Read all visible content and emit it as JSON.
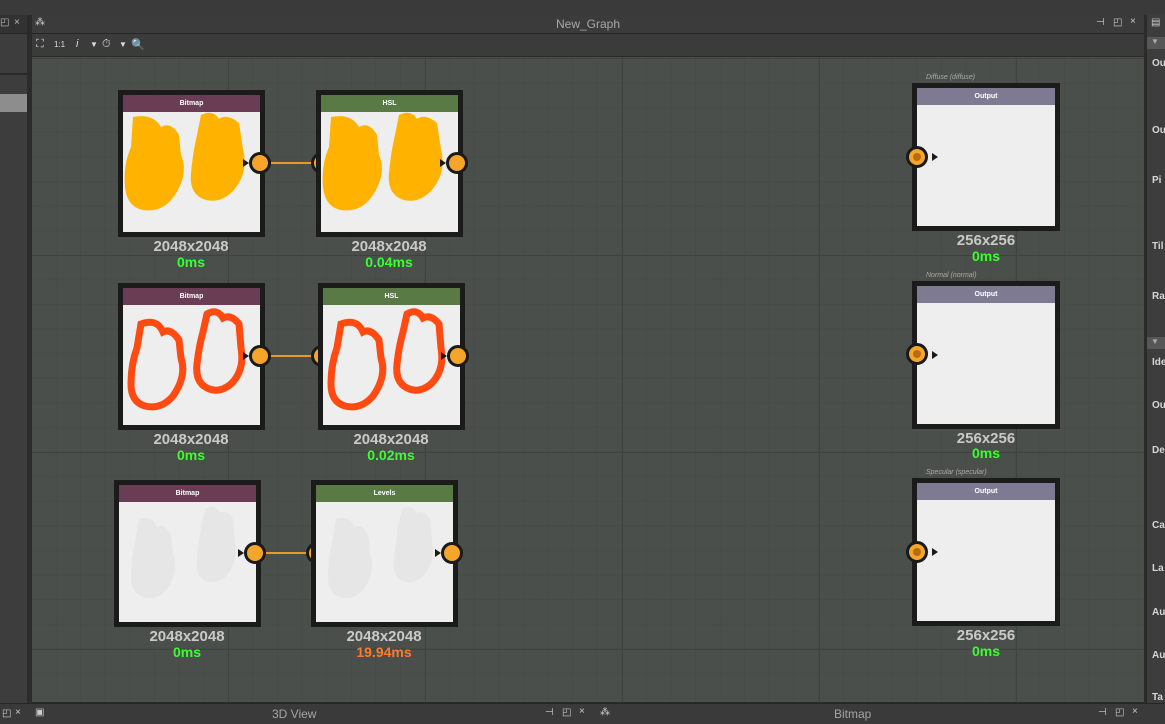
{
  "graph_window": {
    "title": "New_Graph"
  },
  "toolbar": {
    "ratio_label": "1:1",
    "info_label": "i"
  },
  "nodes": [
    {
      "header": "Bitmap",
      "size": "2048x2048",
      "time": "0ms",
      "color": "#6a3d55"
    },
    {
      "header": "HSL",
      "size": "2048x2048",
      "time": "0.04ms",
      "color": "#5a7a45"
    },
    {
      "header": "Bitmap",
      "size": "2048x2048",
      "time": "0ms",
      "color": "#6a3d55"
    },
    {
      "header": "HSL",
      "size": "2048x2048",
      "time": "0.02ms",
      "color": "#5a7a45"
    },
    {
      "header": "Bitmap",
      "size": "2048x2048",
      "time": "0ms",
      "color": "#6a3d55"
    },
    {
      "header": "Levels",
      "size": "2048x2048",
      "time": "19.94ms",
      "color": "#5a7a45"
    }
  ],
  "outputs": [
    {
      "label": "Diffuse (diffuse)",
      "header": "Output",
      "size": "256x256",
      "time": "0ms"
    },
    {
      "label": "Normal (normal)",
      "header": "Output",
      "size": "256x256",
      "time": "0ms"
    },
    {
      "label": "Specular (specular)",
      "header": "Output",
      "size": "256x256",
      "time": "0ms"
    }
  ],
  "right_panel": {
    "labels": [
      "Ou",
      "Ou",
      "Pi",
      "Til",
      "Ra",
      "Ide",
      "Ou",
      "De",
      "Ca",
      "La",
      "Au",
      "Au",
      "Ta"
    ]
  },
  "bottom": {
    "left_title": "3D View",
    "right_title": "Bitmap"
  },
  "colors": {
    "time_ok": "#39ff2d",
    "time_slow": "#ff7a28",
    "wire": "#e89a29",
    "port": "#f5a62a"
  }
}
